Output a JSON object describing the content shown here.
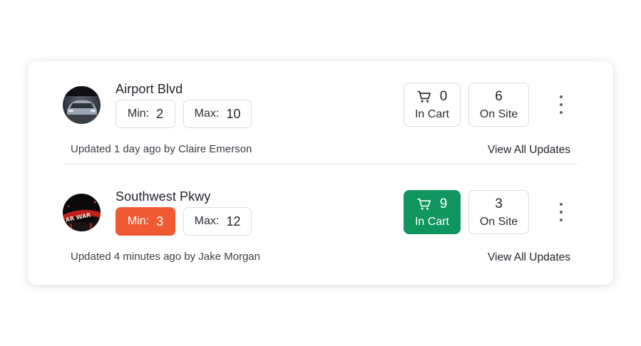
{
  "locations": [
    {
      "name": "Airport Blvd",
      "min_label": "Min:",
      "min_value": "2",
      "max_label": "Max:",
      "max_value": "10",
      "in_cart_value": "0",
      "in_cart_label": "In Cart",
      "on_site_value": "6",
      "on_site_label": "On Site",
      "updated_text": "Updated 1 day ago by Claire Emerson",
      "view_all_label": "View All Updates",
      "avatar_icon": "car-photo-avatar",
      "min_alert": false,
      "cart_active": false
    },
    {
      "name": "Southwest Pkwy",
      "min_label": "Min:",
      "min_value": "3",
      "max_label": "Max:",
      "max_value": "12",
      "in_cart_value": "9",
      "in_cart_label": "In Cart",
      "on_site_value": "3",
      "on_site_label": "On Site",
      "updated_text": "Updated 4 minutes ago by Jake Morgan",
      "view_all_label": "View All Updates",
      "avatar_icon": "neon-sign-photo-avatar",
      "min_alert": true,
      "cart_active": true
    }
  ],
  "colors": {
    "alert": "#f05a32",
    "active": "#10955f",
    "border": "#d9dcdf",
    "kebab": "#5a6472"
  },
  "icons": {
    "cart": "shopping-cart-icon",
    "menu": "kebab-menu-icon"
  }
}
